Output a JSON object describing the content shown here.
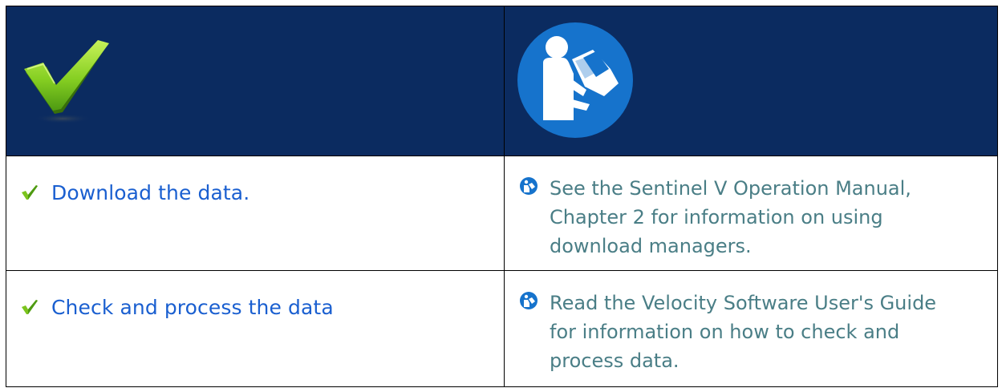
{
  "colors": {
    "header_background": "#0b2b60",
    "step_text": "#1a5fd0",
    "reference_text": "#4a7e86",
    "check_green": "#7cc41e",
    "manual_icon_blue": "#1673cc"
  },
  "header": {
    "left_icon": "green-checkmark-icon",
    "right_icon": "read-manual-icon"
  },
  "rows": [
    {
      "step_icon": "small-checkmark-icon",
      "step": "Download the data.",
      "reference_icon": "manual-bullet-icon",
      "reference": "See the Sentinel V Operation Manual, Chapter 2 for information on using download managers."
    },
    {
      "step_icon": "small-checkmark-icon",
      "step": "Check and process the data",
      "reference_icon": "manual-bullet-icon",
      "reference": "Read the Velocity Software User's Guide for information on how to check and process data."
    }
  ]
}
